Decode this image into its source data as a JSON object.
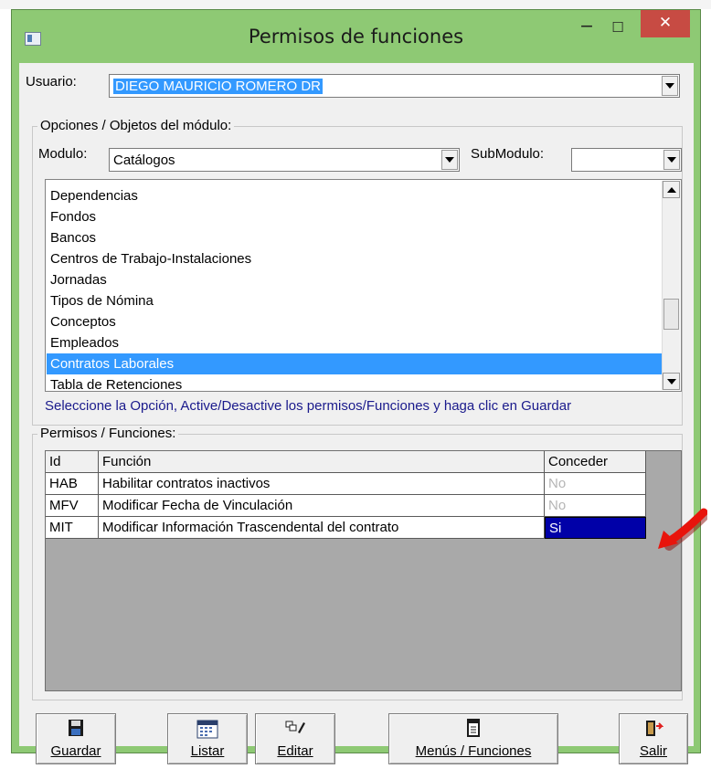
{
  "window": {
    "title": "Permisos de funciones",
    "controls": {
      "minimize": "‒",
      "maximize": "☐",
      "close": "✕"
    }
  },
  "usuario": {
    "label": "Usuario:",
    "value": "DIEGO MAURICIO ROMERO DR"
  },
  "opciones": {
    "title": "Opciones / Objetos del módulo:",
    "modulo_label": "Modulo:",
    "modulo_value": "Catálogos",
    "submodulo_label": "SubModulo:",
    "submodulo_value": "",
    "items": [
      "Dependencias",
      "Fondos",
      "Bancos",
      "Centros de Trabajo-Instalaciones",
      "Jornadas",
      "Tipos de Nómina",
      "Conceptos",
      "Empleados",
      "Contratos Laborales",
      "Tabla de Retenciones"
    ],
    "selected_item": "Contratos Laborales",
    "hint": "Seleccione la Opción, Active/Desactive los permisos/Funciones y haga clic en Guardar"
  },
  "permisos": {
    "title": "Permisos / Funciones:",
    "columns": [
      "Id",
      "Función",
      "Conceder"
    ],
    "rows": [
      {
        "id": "HAB",
        "funcion": "Habilitar contratos inactivos",
        "conceder": "No"
      },
      {
        "id": "MFV",
        "funcion": "Modificar Fecha de Vinculación",
        "conceder": "No"
      },
      {
        "id": "MIT",
        "funcion": "Modificar Información Trascendental del contrato",
        "conceder": "Si"
      }
    ]
  },
  "buttons": {
    "guardar": "Guardar",
    "listar": "Listar",
    "editar": "Editar",
    "menus": "Menús / Funciones",
    "salir": "Salir"
  },
  "colors": {
    "window_frame": "#8ec974",
    "close_button": "#c74b43",
    "selection": "#3399ff",
    "granted_cell": "#0000a8",
    "hint_text": "#1a1a8c",
    "annotation_arrow": "#e8140c"
  },
  "icons": {
    "app": "app-window-icon",
    "guardar": "floppy-disk-icon",
    "listar": "calendar-list-icon",
    "editar": "edit-pencil-icon",
    "menus": "document-menu-icon",
    "salir": "exit-door-icon",
    "annotation": "red-arrow-icon"
  }
}
